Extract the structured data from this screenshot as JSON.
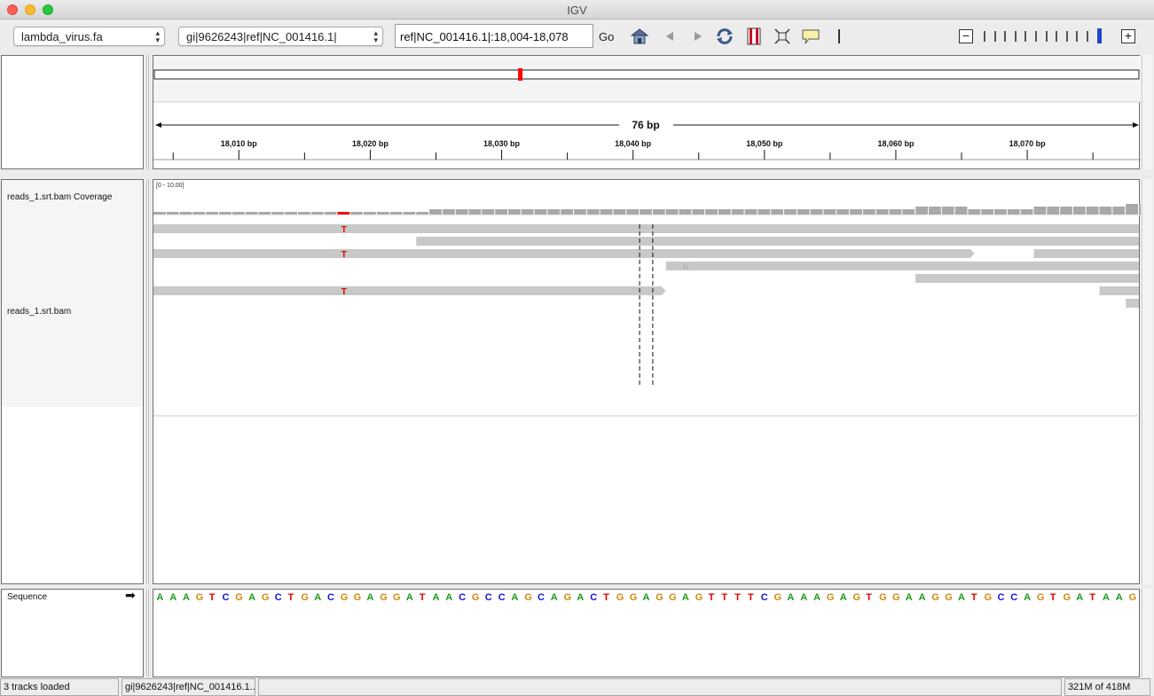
{
  "window": {
    "title": "IGV"
  },
  "toolbar": {
    "genome": "lambda_virus.fa",
    "chromosome": "gi|9626243|ref|NC_001416.1|",
    "locus": "ref|NC_001416.1|:18,004-18,078",
    "go_label": "Go",
    "icons": [
      "home-icon",
      "back-icon",
      "forward-icon",
      "refresh-icon",
      "roi-icon",
      "resize-icon",
      "popup-text-icon",
      "ruler-line-icon"
    ],
    "zoom_minus": "−",
    "zoom_plus": "+",
    "zoom_levels": 12,
    "zoom_current": 11
  },
  "ruler": {
    "span_label": "76 bp",
    "start": 18003.5,
    "end": 18078.5,
    "ticks": [
      {
        "pos": 18010,
        "label": "18,010 bp"
      },
      {
        "pos": 18020,
        "label": "18,020 bp"
      },
      {
        "pos": 18030,
        "label": "18,030 bp"
      },
      {
        "pos": 18040,
        "label": "18,040 bp"
      },
      {
        "pos": 18050,
        "label": "18,050 bp"
      },
      {
        "pos": 18060,
        "label": "18,060 bp"
      },
      {
        "pos": 18070,
        "label": "18,070 bp"
      }
    ],
    "minor_ticks": [
      18005,
      18015,
      18025,
      18035,
      18045,
      18055,
      18065,
      18075
    ]
  },
  "chromosome_ideogram": {
    "current_view_fraction": 0.37
  },
  "tracks": {
    "coverage_label": "reads_1.srt.bam Coverage",
    "coverage_range": "[0 - 10.00]",
    "alignment_label": "reads_1.srt.bam",
    "sequence_label": "Sequence",
    "sequence_arrow": "➡"
  },
  "coverage": {
    "depths": [
      1,
      1,
      1,
      1,
      1,
      1,
      1,
      1,
      1,
      1,
      1,
      1,
      1,
      1,
      1,
      1,
      1,
      1,
      1,
      1,
      1,
      2,
      2,
      2,
      2,
      2,
      2,
      2,
      2,
      2,
      2,
      2,
      2,
      2,
      2,
      2,
      2,
      2,
      2,
      2,
      2,
      2,
      2,
      2,
      2,
      2,
      2,
      2,
      2,
      2,
      2,
      2,
      2,
      2,
      2,
      2,
      2,
      2,
      3,
      3,
      3,
      3,
      2,
      2,
      2,
      2,
      2,
      3,
      3,
      3,
      3,
      3,
      3,
      3,
      4,
      4
    ],
    "max": 10,
    "mismatch_index": 14,
    "mismatch_color": "#ff0000"
  },
  "alignments": [
    {
      "row": 0,
      "start": 0,
      "end": 75,
      "mismatches": [
        {
          "index": 14,
          "base": "T"
        }
      ],
      "arrow": "none"
    },
    {
      "row": 1,
      "start": 20,
      "end": 75,
      "mismatches": [],
      "arrow": "none"
    },
    {
      "row": 2,
      "start": 0,
      "end": 62.5,
      "mismatches": [
        {
          "index": 14,
          "base": "T"
        }
      ],
      "arrow": "right"
    },
    {
      "row": 2,
      "start": 67,
      "end": 75,
      "mismatches": [],
      "arrow": "none"
    },
    {
      "row": 3,
      "start": 39,
      "end": 75,
      "mismatches": [
        {
          "index": 40,
          "base": "N"
        }
      ],
      "arrow": "none"
    },
    {
      "row": 4,
      "start": 58,
      "end": 75,
      "mismatches": [],
      "arrow": "none"
    },
    {
      "row": 5,
      "start": 0,
      "end": 39,
      "mismatches": [
        {
          "index": 14,
          "base": "T"
        }
      ],
      "arrow": "right"
    },
    {
      "row": 5,
      "start": 72,
      "end": 75,
      "mismatches": [],
      "arrow": "none"
    },
    {
      "row": 6,
      "start": 74,
      "end": 75,
      "mismatches": [],
      "arrow": "none"
    }
  ],
  "center_line_positions": [
    18040.5,
    18041.5
  ],
  "sequence": "AAAGTCGAGCTGACGGAGGATAACGCCAGCAGACTGGAGGAGTTTTCGAAAGAGTGGAAGGATGCCAGTGATAAG",
  "base_colors": {
    "A": "#1a9c1a",
    "C": "#1010e0",
    "G": "#d1870e",
    "T": "#e00000",
    "N": "#777777"
  },
  "status": {
    "tracks_loaded": "3 tracks loaded",
    "locus": "gi|9626243|ref|NC_001416.1...",
    "middle": "",
    "memory": "321M of 418M"
  }
}
